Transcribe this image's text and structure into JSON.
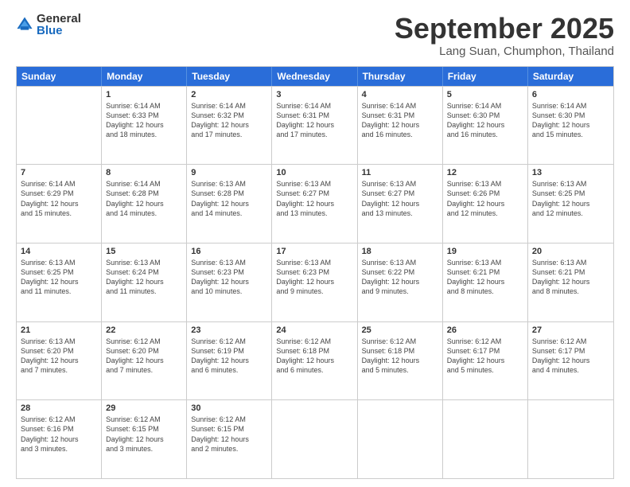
{
  "logo": {
    "general": "General",
    "blue": "Blue"
  },
  "title": "September 2025",
  "location": "Lang Suan, Chumphon, Thailand",
  "days_of_week": [
    "Sunday",
    "Monday",
    "Tuesday",
    "Wednesday",
    "Thursday",
    "Friday",
    "Saturday"
  ],
  "weeks": [
    [
      {
        "day": "",
        "info": ""
      },
      {
        "day": "1",
        "info": "Sunrise: 6:14 AM\nSunset: 6:33 PM\nDaylight: 12 hours\nand 18 minutes."
      },
      {
        "day": "2",
        "info": "Sunrise: 6:14 AM\nSunset: 6:32 PM\nDaylight: 12 hours\nand 17 minutes."
      },
      {
        "day": "3",
        "info": "Sunrise: 6:14 AM\nSunset: 6:31 PM\nDaylight: 12 hours\nand 17 minutes."
      },
      {
        "day": "4",
        "info": "Sunrise: 6:14 AM\nSunset: 6:31 PM\nDaylight: 12 hours\nand 16 minutes."
      },
      {
        "day": "5",
        "info": "Sunrise: 6:14 AM\nSunset: 6:30 PM\nDaylight: 12 hours\nand 16 minutes."
      },
      {
        "day": "6",
        "info": "Sunrise: 6:14 AM\nSunset: 6:30 PM\nDaylight: 12 hours\nand 15 minutes."
      }
    ],
    [
      {
        "day": "7",
        "info": "Sunrise: 6:14 AM\nSunset: 6:29 PM\nDaylight: 12 hours\nand 15 minutes."
      },
      {
        "day": "8",
        "info": "Sunrise: 6:14 AM\nSunset: 6:28 PM\nDaylight: 12 hours\nand 14 minutes."
      },
      {
        "day": "9",
        "info": "Sunrise: 6:13 AM\nSunset: 6:28 PM\nDaylight: 12 hours\nand 14 minutes."
      },
      {
        "day": "10",
        "info": "Sunrise: 6:13 AM\nSunset: 6:27 PM\nDaylight: 12 hours\nand 13 minutes."
      },
      {
        "day": "11",
        "info": "Sunrise: 6:13 AM\nSunset: 6:27 PM\nDaylight: 12 hours\nand 13 minutes."
      },
      {
        "day": "12",
        "info": "Sunrise: 6:13 AM\nSunset: 6:26 PM\nDaylight: 12 hours\nand 12 minutes."
      },
      {
        "day": "13",
        "info": "Sunrise: 6:13 AM\nSunset: 6:25 PM\nDaylight: 12 hours\nand 12 minutes."
      }
    ],
    [
      {
        "day": "14",
        "info": "Sunrise: 6:13 AM\nSunset: 6:25 PM\nDaylight: 12 hours\nand 11 minutes."
      },
      {
        "day": "15",
        "info": "Sunrise: 6:13 AM\nSunset: 6:24 PM\nDaylight: 12 hours\nand 11 minutes."
      },
      {
        "day": "16",
        "info": "Sunrise: 6:13 AM\nSunset: 6:23 PM\nDaylight: 12 hours\nand 10 minutes."
      },
      {
        "day": "17",
        "info": "Sunrise: 6:13 AM\nSunset: 6:23 PM\nDaylight: 12 hours\nand 9 minutes."
      },
      {
        "day": "18",
        "info": "Sunrise: 6:13 AM\nSunset: 6:22 PM\nDaylight: 12 hours\nand 9 minutes."
      },
      {
        "day": "19",
        "info": "Sunrise: 6:13 AM\nSunset: 6:21 PM\nDaylight: 12 hours\nand 8 minutes."
      },
      {
        "day": "20",
        "info": "Sunrise: 6:13 AM\nSunset: 6:21 PM\nDaylight: 12 hours\nand 8 minutes."
      }
    ],
    [
      {
        "day": "21",
        "info": "Sunrise: 6:13 AM\nSunset: 6:20 PM\nDaylight: 12 hours\nand 7 minutes."
      },
      {
        "day": "22",
        "info": "Sunrise: 6:12 AM\nSunset: 6:20 PM\nDaylight: 12 hours\nand 7 minutes."
      },
      {
        "day": "23",
        "info": "Sunrise: 6:12 AM\nSunset: 6:19 PM\nDaylight: 12 hours\nand 6 minutes."
      },
      {
        "day": "24",
        "info": "Sunrise: 6:12 AM\nSunset: 6:18 PM\nDaylight: 12 hours\nand 6 minutes."
      },
      {
        "day": "25",
        "info": "Sunrise: 6:12 AM\nSunset: 6:18 PM\nDaylight: 12 hours\nand 5 minutes."
      },
      {
        "day": "26",
        "info": "Sunrise: 6:12 AM\nSunset: 6:17 PM\nDaylight: 12 hours\nand 5 minutes."
      },
      {
        "day": "27",
        "info": "Sunrise: 6:12 AM\nSunset: 6:17 PM\nDaylight: 12 hours\nand 4 minutes."
      }
    ],
    [
      {
        "day": "28",
        "info": "Sunrise: 6:12 AM\nSunset: 6:16 PM\nDaylight: 12 hours\nand 3 minutes."
      },
      {
        "day": "29",
        "info": "Sunrise: 6:12 AM\nSunset: 6:15 PM\nDaylight: 12 hours\nand 3 minutes."
      },
      {
        "day": "30",
        "info": "Sunrise: 6:12 AM\nSunset: 6:15 PM\nDaylight: 12 hours\nand 2 minutes."
      },
      {
        "day": "",
        "info": ""
      },
      {
        "day": "",
        "info": ""
      },
      {
        "day": "",
        "info": ""
      },
      {
        "day": "",
        "info": ""
      }
    ]
  ]
}
